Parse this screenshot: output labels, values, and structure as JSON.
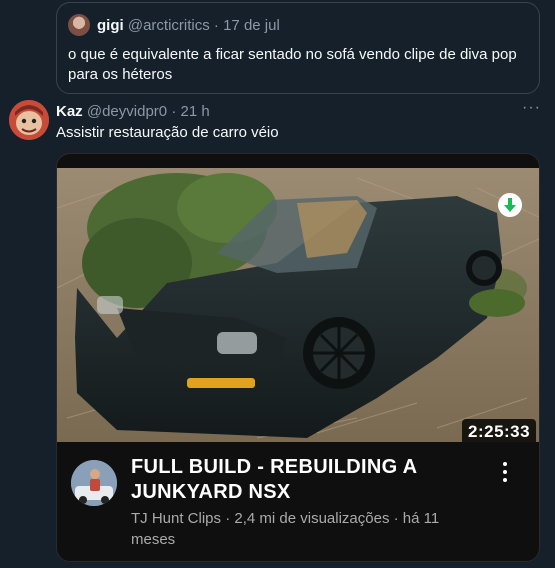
{
  "quoted_tweet": {
    "display_name": "gigi",
    "handle": "@arcticritics",
    "separator": "·",
    "date": "17 de jul",
    "text": "o que é equivalente a ficar sentado no sofá vendo clipe de diva pop para os héteros"
  },
  "tweet": {
    "display_name": "Kaz",
    "handle": "@deyvidpr0",
    "separator": "·",
    "time": "21 h",
    "text": "Assistir restauração de carro véio",
    "more_label": "···"
  },
  "video_card": {
    "duration": "2:25:33",
    "title": "FULL BUILD - REBUILDING A JUNKYARD NSX",
    "channel": "TJ Hunt Clips",
    "views": "2,4 mi de visualizações",
    "age": "há 11 meses",
    "meta_separator": " · "
  },
  "icons": {
    "download": "download-arrow-icon",
    "more": "more-horizontal-icon",
    "kebab": "more-vertical-icon"
  },
  "colors": {
    "background": "#15202b",
    "border": "#38444d",
    "muted_text": "#8b98a5",
    "card_background": "#0f0f0f",
    "download_arrow": "#1db954"
  }
}
